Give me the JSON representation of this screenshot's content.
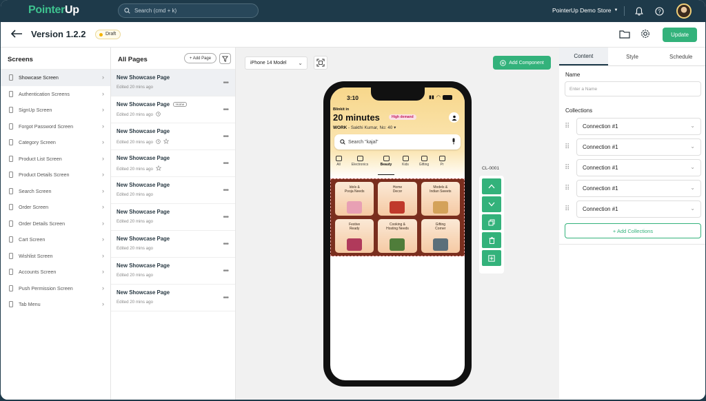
{
  "topbar": {
    "logo_main": "Pointer",
    "logo_accent": "Up",
    "search_placeholder": "Search (cmd + k)",
    "store_name": "PointerUp Demo Store"
  },
  "subbar": {
    "version": "Version 1.2.2",
    "status_badge": "Draft",
    "update_label": "Update"
  },
  "screens": {
    "title": "Screens",
    "items": [
      {
        "label": "Showcase Screen",
        "active": true
      },
      {
        "label": "Authentication Screens"
      },
      {
        "label": "SignUp Screen"
      },
      {
        "label": "Forgot Password Screen"
      },
      {
        "label": "Category Screen"
      },
      {
        "label": "Product List Screen"
      },
      {
        "label": "Product Details Screen"
      },
      {
        "label": "Search Screen"
      },
      {
        "label": "Order Screen"
      },
      {
        "label": "Order Details Screen"
      },
      {
        "label": "Cart Screen"
      },
      {
        "label": "Wishlist Screen"
      },
      {
        "label": "Accounts Screen"
      },
      {
        "label": "Push Permission Screen"
      },
      {
        "label": "Tab Menu"
      }
    ]
  },
  "pages": {
    "title": "All Pages",
    "add_label": "+ Add Page",
    "items": [
      {
        "title": "New Showcase Page",
        "meta": "Edited 20 mins ago",
        "badge": "",
        "clock": false,
        "star": false,
        "active": true
      },
      {
        "title": "New Showcase Page",
        "meta": "Edited 20 mins ago",
        "badge": "Home",
        "clock": true,
        "star": false
      },
      {
        "title": "New Showcase Page",
        "meta": "Edited 20 mins ago",
        "badge": "",
        "clock": true,
        "star": true
      },
      {
        "title": "New Showcase Page",
        "meta": "Edited 20 mins ago",
        "badge": "",
        "clock": false,
        "star": true
      },
      {
        "title": "New Showcase Page",
        "meta": "Edited 20 mins ago",
        "badge": "",
        "clock": false,
        "star": false
      },
      {
        "title": "New Showcase Page",
        "meta": "Edited 20 mins ago",
        "badge": "",
        "clock": false,
        "star": false
      },
      {
        "title": "New Showcase Page",
        "meta": "Edited 20 mins ago",
        "badge": "",
        "clock": false,
        "star": false
      },
      {
        "title": "New Showcase Page",
        "meta": "Edited 20 mins ago",
        "badge": "",
        "clock": false,
        "star": false
      },
      {
        "title": "New Showcase Page",
        "meta": "Edited 20 mins ago",
        "badge": "",
        "clock": false,
        "star": false
      }
    ]
  },
  "canvas": {
    "device_model": "iPhone 14 Model",
    "add_component_label": "Add Component",
    "component_id": "CL-0001"
  },
  "phone": {
    "time": "3:10",
    "brand": "Blinkit in",
    "eta": "20 minutes",
    "demand_badge": "High demand",
    "address_label": "WORK",
    "address": " - Sakthi Kumar, No: 40",
    "search_placeholder": "Search \"kajal\"",
    "categories": [
      {
        "label": "All"
      },
      {
        "label": "Electronics"
      },
      {
        "label": "Beauty",
        "active": true
      },
      {
        "label": "Kids"
      },
      {
        "label": "Gifting"
      },
      {
        "label": "Pr"
      }
    ],
    "tiles": [
      {
        "label": "Idols &\nPooja Needs",
        "color": "#e8a0b4"
      },
      {
        "label": "Home\nDecor",
        "color": "#c0392b"
      },
      {
        "label": "Models &\nIndian Sweets",
        "color": "#d4a25a"
      },
      {
        "label": "Festive\nReady",
        "color": "#b03a5b"
      },
      {
        "label": "Cooking &\nHosting Needs",
        "color": "#4f7d3a"
      },
      {
        "label": "Gifting\nCorner",
        "color": "#5b6f7a"
      }
    ]
  },
  "props": {
    "tabs": [
      {
        "label": "Content",
        "active": true
      },
      {
        "label": "Style"
      },
      {
        "label": "Schedule"
      }
    ],
    "name_label": "Name",
    "name_placeholder": "Enter a Name",
    "collections_label": "Collections",
    "collections": [
      "Connection #1",
      "Connection #1",
      "Connection #1",
      "Connection #1",
      "Connection #1"
    ],
    "add_collections_label": "+ Add Collections"
  },
  "colors": {
    "topbar": "#1e3a4a",
    "accent": "#33b27b",
    "draft": "#f4b400"
  }
}
